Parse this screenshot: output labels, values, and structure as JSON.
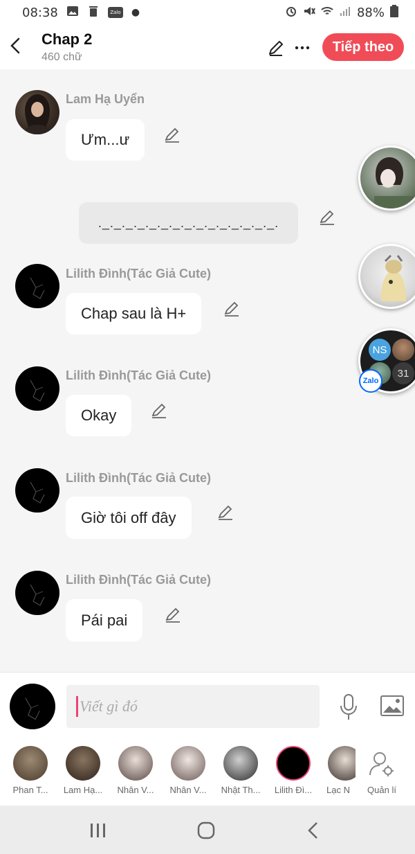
{
  "status_bar": {
    "time": "08:38",
    "battery": "88%",
    "zalo_badge": "Zalo"
  },
  "header": {
    "title": "Chap 2",
    "subtitle": "460 chữ",
    "next_label": "Tiếp theo"
  },
  "messages": [
    {
      "sender": "Lam Hạ Uyển",
      "text": "Ưm...ư"
    },
    {
      "sender": "",
      "text": "._._._._._._._._._._._._._._._."
    },
    {
      "sender": "Lilith Đình(Tác Giả Cute)",
      "text": "Chap sau là H+"
    },
    {
      "sender": "Lilith Đình(Tác Giả Cute)",
      "text": "Okay"
    },
    {
      "sender": "Lilith Đình(Tác Giả Cute)",
      "text": "Giờ tôi off đây"
    },
    {
      "sender": "Lilith Đình(Tác Giả Cute)",
      "text": "Pái pai"
    }
  ],
  "floating_bubbles": {
    "group_initials": "NS",
    "group_count": "31",
    "zalo_label": "Zalo"
  },
  "composer": {
    "placeholder": "Viết gì đó"
  },
  "members": [
    {
      "name": "Phan T..."
    },
    {
      "name": "Lam Hạ..."
    },
    {
      "name": "Nhân V..."
    },
    {
      "name": "Nhân V..."
    },
    {
      "name": "Nhật Th..."
    },
    {
      "name": "Lilith Đì..."
    },
    {
      "name": "Lạc N"
    },
    {
      "name": "Quản lí"
    }
  ]
}
